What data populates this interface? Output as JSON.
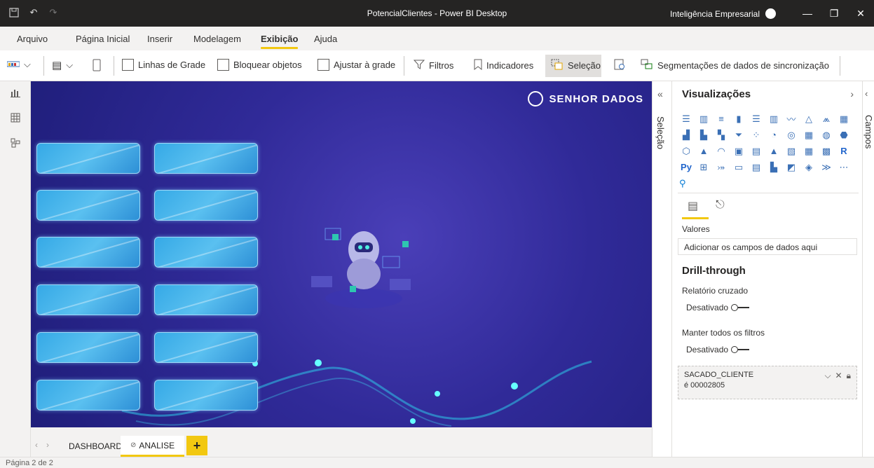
{
  "window": {
    "title": "PotencialClientes - Power BI Desktop",
    "account": "Inteligência Empresarial"
  },
  "menu": {
    "items": [
      "Arquivo",
      "Página Inicial",
      "Inserir",
      "Modelagem",
      "Exibição",
      "Ajuda"
    ],
    "active": "Exibição"
  },
  "ribbon": {
    "gridlines": "Linhas de Grade",
    "lock_objects": "Bloquear objetos",
    "snap_grid": "Ajustar à grade",
    "filters": "Filtros",
    "bookmarks": "Indicadores",
    "selection": "Seleção",
    "sync_slicers": "Segmentações de dados de sincronização"
  },
  "canvas": {
    "logo_text": "SENHOR DADOS"
  },
  "selection_pane": {
    "label": "Seleção"
  },
  "visualizations": {
    "title": "Visualizações",
    "values_label": "Valores",
    "field_placeholder": "Adicionar os campos de dados aqui",
    "drill_title": "Drill-through",
    "cross_report_label": "Relatório cruzado",
    "cross_report_state": "Desativado",
    "keep_filters_label": "Manter todos os filtros",
    "keep_filters_state": "Desativado",
    "filter_field": "SACADO_CLIENTE",
    "filter_value": "é 00002805"
  },
  "fields_pane": {
    "label": "Campos"
  },
  "pages": {
    "tabs": [
      "DASHBOARD",
      "ANALISE"
    ],
    "active": "ANALISE",
    "add": "+"
  },
  "status": {
    "page": "Página 2 de 2"
  },
  "colors": {
    "accent": "#f2c811",
    "canvas_bg": "#302a98",
    "card": "#35a9e6"
  }
}
